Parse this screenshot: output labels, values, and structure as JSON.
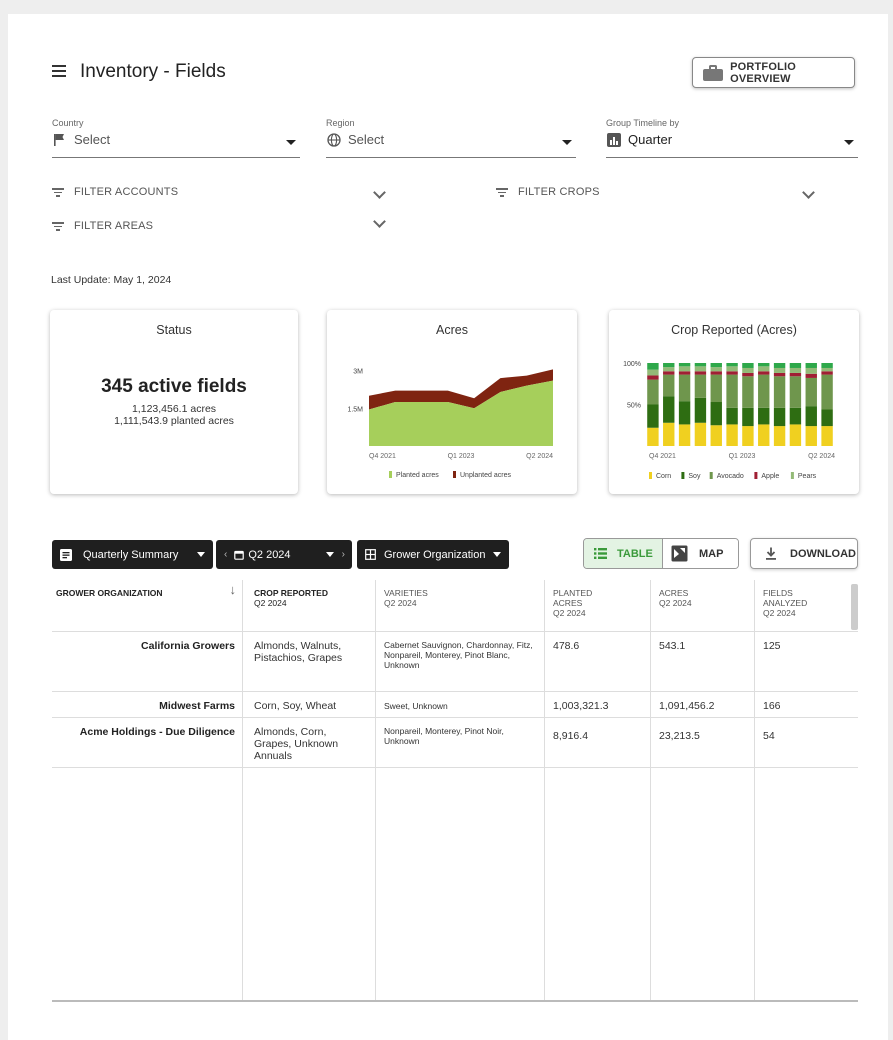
{
  "header": {
    "title": "Inventory - Fields",
    "portfolio_label": "PORTFOLIO OVERVIEW"
  },
  "filters": {
    "country": {
      "label": "Country",
      "value": "Select"
    },
    "region": {
      "label": "Region",
      "value": "Select"
    },
    "timeline": {
      "label": "Group Timeline by",
      "value": "Quarter"
    },
    "accounts": "FILTER ACCOUNTS",
    "crops": "FILTER CROPS",
    "areas": "FILTER AREAS"
  },
  "last_update": "Last Update: May 1, 2024",
  "status_card": {
    "title": "Status",
    "active": "345 active fields",
    "acres": "1,123,456.1 acres",
    "planted": "1,111,543.9 planted acres"
  },
  "chart_data": [
    {
      "type": "area",
      "title": "Acres",
      "x_ticks": [
        "Q4 2021",
        "Q1 2023",
        "Q2 2024"
      ],
      "y_ticks": [
        "3M",
        "1.5M"
      ],
      "ylim": [
        0,
        3500000
      ],
      "x": [
        0,
        1,
        2,
        3,
        4,
        5,
        6,
        7
      ],
      "series": [
        {
          "name": "Planted acres",
          "color": "#a6cf5b",
          "values": [
            1450000,
            1750000,
            1750000,
            1750000,
            1500000,
            2150000,
            2400000,
            2600000
          ]
        },
        {
          "name": "Unplanted acres",
          "color": "#7f2411",
          "values": [
            550000,
            450000,
            450000,
            450000,
            400000,
            550000,
            400000,
            450000
          ]
        }
      ]
    },
    {
      "type": "bar",
      "stacked": true,
      "title": "Crop Reported (Acres)",
      "x_ticks": [
        "Q4 2021",
        "Q1 2023",
        "Q2 2024"
      ],
      "y_ticks": [
        "100%",
        "50%"
      ],
      "ylim": [
        0,
        100
      ],
      "categories": [
        "1",
        "2",
        "3",
        "4",
        "5",
        "6",
        "7",
        "8",
        "9",
        "10",
        "11",
        "12"
      ],
      "series": [
        {
          "name": "Corn",
          "color": "#f0d020",
          "values": [
            22,
            28,
            26,
            28,
            25,
            26,
            24,
            26,
            24,
            26,
            24,
            24
          ]
        },
        {
          "name": "Soy",
          "color": "#2e6d12",
          "values": [
            28,
            32,
            28,
            30,
            28,
            20,
            22,
            20,
            22,
            20,
            24,
            20
          ]
        },
        {
          "name": "Avocado",
          "color": "#6f964d",
          "values": [
            30,
            26,
            32,
            28,
            33,
            40,
            38,
            40,
            38,
            38,
            34,
            42
          ]
        },
        {
          "name": "Apple",
          "color": "#a01f34",
          "values": [
            5,
            4,
            4,
            4,
            4,
            4,
            4,
            4,
            4,
            4,
            5,
            4
          ]
        },
        {
          "name": "Pears",
          "color": "#93ba77",
          "values": [
            7,
            5,
            6,
            6,
            5,
            6,
            6,
            6,
            6,
            6,
            7,
            4
          ]
        },
        {
          "name": "",
          "color": "#2ea84a",
          "values": [
            8,
            5,
            4,
            4,
            5,
            4,
            6,
            4,
            6,
            6,
            6,
            6
          ]
        }
      ]
    }
  ],
  "toolbar": {
    "summary": "Quarterly Summary",
    "period": "Q2 2024",
    "group": "Grower Organization",
    "table_label": "TABLE",
    "map_label": "MAP",
    "download_label": "DOWNLOAD"
  },
  "table": {
    "headers": [
      {
        "title": "GROWER ORGANIZATION",
        "sub": ""
      },
      {
        "title": "CROP REPORTED",
        "sub": "Q2 2024"
      },
      {
        "title": "VARIETIES",
        "sub": "Q2 2024"
      },
      {
        "title": "PLANTED ACRES",
        "sub": "Q2 2024"
      },
      {
        "title": "ACRES",
        "sub": "Q2 2024"
      },
      {
        "title": "FIELDS ANALYZED",
        "sub": "Q2 2024"
      }
    ],
    "rows": [
      {
        "org": "California Growers",
        "crops": "Almonds, Walnuts, Pistachios, Grapes",
        "varieties": "Cabernet Sauvignon, Chardonnay, Fitz, Nonpareil, Monterey, Pinot Blanc, Unknown",
        "planted": "478.6",
        "acres": "543.1",
        "fields": "125"
      },
      {
        "org": "Midwest Farms",
        "crops": "Corn, Soy, Wheat",
        "varieties": "Sweet, Unknown",
        "planted": "1,003,321.3",
        "acres": "1,091,456.2",
        "fields": "166"
      },
      {
        "org": "Acme Holdings - Due Diligence",
        "crops": "Almonds, Corn, Grapes, Unknown Annuals",
        "varieties": "Nonpareil, Monterey, Pinot Noir, Unknown",
        "planted": "8,916.4",
        "acres": "23,213.5",
        "fields": "54"
      }
    ]
  }
}
